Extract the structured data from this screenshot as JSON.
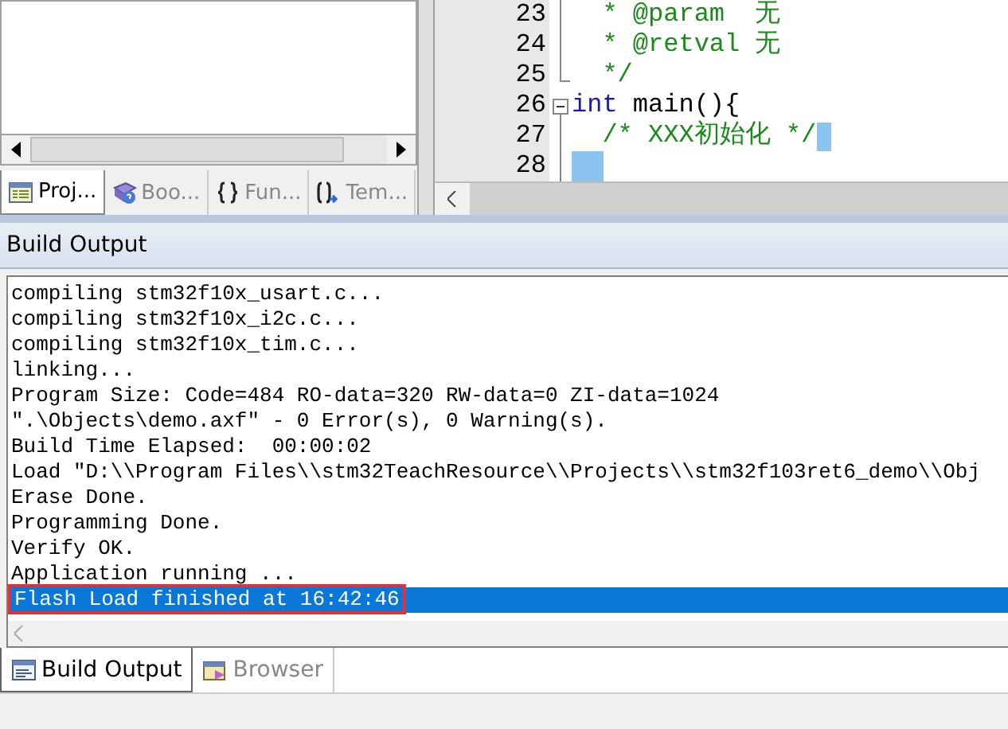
{
  "project_pane": {
    "tabs": [
      {
        "label": "Proj...",
        "selected": true
      },
      {
        "label": "Boo...",
        "selected": false
      },
      {
        "label": "Fun...",
        "selected": false
      },
      {
        "label": "Tem...",
        "selected": false
      }
    ]
  },
  "editor": {
    "lines": [
      {
        "number": "23",
        "collapsible": false,
        "cursor": false,
        "selection": false,
        "tokens": [
          {
            "text": "  * @param  无",
            "kind": "comment"
          }
        ]
      },
      {
        "number": "24",
        "collapsible": false,
        "cursor": false,
        "selection": false,
        "tokens": [
          {
            "text": "  * @retval 无",
            "kind": "comment"
          }
        ]
      },
      {
        "number": "25",
        "collapsible": false,
        "cursor": false,
        "selection": false,
        "tokens": [
          {
            "text": "  */",
            "kind": "comment"
          }
        ]
      },
      {
        "number": "26",
        "collapsible": true,
        "cursor": false,
        "selection": false,
        "tokens": [
          {
            "text": "int",
            "kind": "keyword"
          },
          {
            "text": " main(){",
            "kind": "plain"
          }
        ]
      },
      {
        "number": "27",
        "collapsible": false,
        "cursor": true,
        "selection": false,
        "tokens": [
          {
            "text": "  /* XXX初始化 */",
            "kind": "comment"
          }
        ]
      },
      {
        "number": "28",
        "collapsible": false,
        "cursor": false,
        "selection": true
      }
    ]
  },
  "build_output": {
    "title": "Build Output",
    "lines": [
      {
        "text": "compiling stm32f10x_usart.c...",
        "selected": false,
        "annotated": false
      },
      {
        "text": "compiling stm32f10x_i2c.c...",
        "selected": false,
        "annotated": false
      },
      {
        "text": "compiling stm32f10x_tim.c...",
        "selected": false,
        "annotated": false
      },
      {
        "text": "linking...",
        "selected": false,
        "annotated": false
      },
      {
        "text": "Program Size: Code=484 RO-data=320 RW-data=0 ZI-data=1024",
        "selected": false,
        "annotated": false
      },
      {
        "text": "\".\\Objects\\demo.axf\" - 0 Error(s), 0 Warning(s).",
        "selected": false,
        "annotated": false
      },
      {
        "text": "Build Time Elapsed:  00:00:02",
        "selected": false,
        "annotated": false
      },
      {
        "text": "Load \"D:\\\\Program Files\\\\stm32TeachResource\\\\Projects\\\\stm32f103ret6_demo\\\\Obj",
        "selected": false,
        "annotated": false
      },
      {
        "text": "Erase Done.",
        "selected": false,
        "annotated": false
      },
      {
        "text": "Programming Done.",
        "selected": false,
        "annotated": false
      },
      {
        "text": "Verify OK.",
        "selected": false,
        "annotated": false
      },
      {
        "text": "Application running ...",
        "selected": false,
        "annotated": false
      },
      {
        "text": "Flash Load finished at 16:42:46",
        "selected": true,
        "annotated": true
      }
    ],
    "tabs": [
      {
        "label": "Build Output",
        "selected": true
      },
      {
        "label": "Browser",
        "selected": false
      }
    ]
  }
}
